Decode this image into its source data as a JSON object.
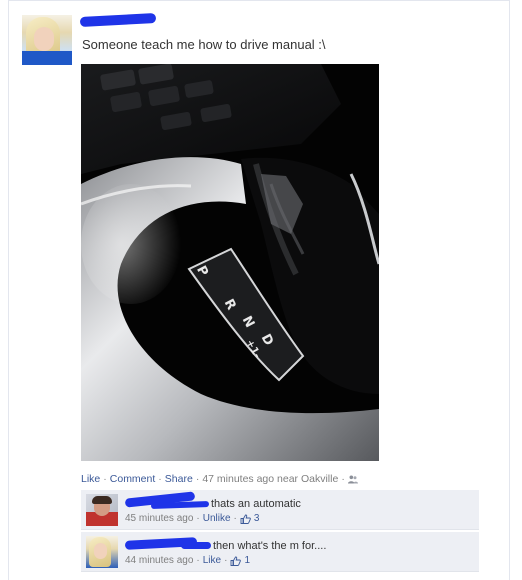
{
  "post": {
    "status_text": "Someone teach me how to drive manual :\\",
    "actions": {
      "like": "Like",
      "comment": "Comment",
      "share": "Share",
      "separator": "·",
      "time_location": "47 minutes ago near Oakville"
    }
  },
  "shifter_labels": [
    "P",
    "R",
    "N",
    "D",
    "+1-"
  ],
  "comments": [
    {
      "text": "thats an automatic",
      "time": "45 minutes ago",
      "action": "Unlike",
      "like_count": "3"
    },
    {
      "text": "then what's the m for....",
      "time": "44 minutes ago",
      "action": "Like",
      "like_count": "1"
    }
  ],
  "colors": {
    "link": "#3b5998",
    "redaction": "#1f34e8",
    "comment_bg": "#edeff4"
  }
}
